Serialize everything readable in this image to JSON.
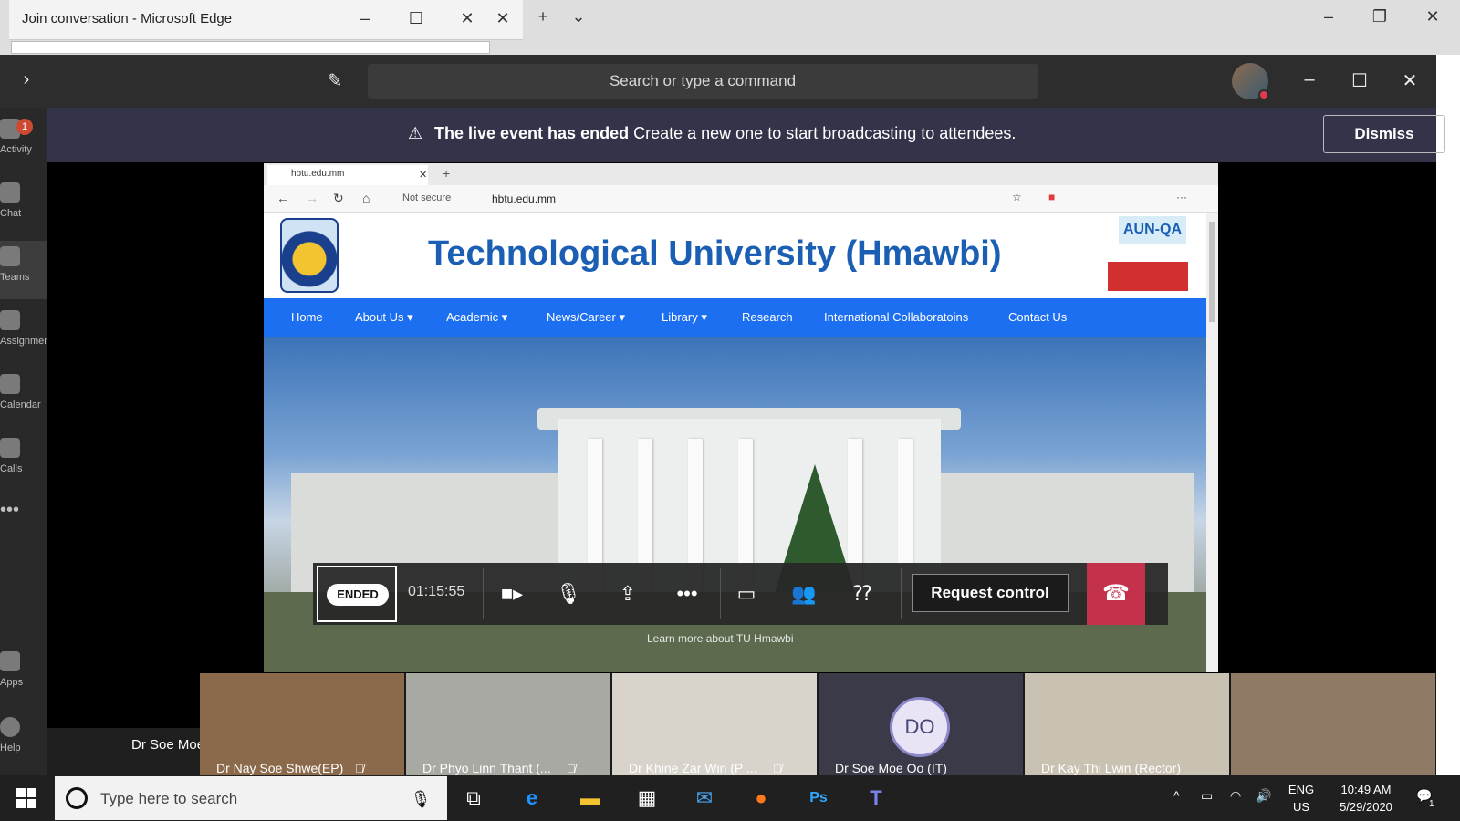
{
  "edge": {
    "title": "Join conversation - Microsoft Edge"
  },
  "teams": {
    "search_placeholder": "Search or type a command",
    "rail": [
      {
        "label": "Activity",
        "badge": "1"
      },
      {
        "label": "Chat"
      },
      {
        "label": "Teams"
      },
      {
        "label": "Assignments"
      },
      {
        "label": "Calendar"
      },
      {
        "label": "Calls"
      },
      {
        "label": "Apps"
      },
      {
        "label": "Help"
      }
    ],
    "banner": {
      "bold": "The live event has ended",
      "text": "Create a new one to start broadcasting to attendees.",
      "dismiss": "Dismiss"
    },
    "presenter": "Dr Soe Moe Oo (IT)"
  },
  "shared": {
    "tab_title": "hbtu.edu.mm",
    "not_secure": "Not secure",
    "url": "hbtu.edu.mm",
    "site_title": "Technological University (Hmawbi)",
    "badge_top": "AUN-QA",
    "menu": [
      "Home",
      "About Us ▾",
      "Academic ▾",
      "News/Career ▾",
      "Library ▾",
      "Research",
      "International Collaboratoins",
      "Contact Us"
    ],
    "hero_caption": "Learn more about TU Hmawbi"
  },
  "controls": {
    "status": "ENDED",
    "timer": "01:15:55",
    "request_control": "Request control"
  },
  "participants": [
    {
      "name": "Dr Nay Soe Shwe(EP)",
      "muted": true,
      "bg": "#8a6a4a"
    },
    {
      "name": "Dr Phyo Linn Thant (...",
      "muted": true,
      "bg": "#a9a9a4"
    },
    {
      "name": "Dr Khine Zar Win (P ...",
      "muted": true,
      "bg": "#d8d4cc"
    },
    {
      "name": "Dr Soe Moe Oo (IT)",
      "initials": "DO",
      "muted": false,
      "bg": "#3a3a48"
    },
    {
      "name": "Dr Kay Thi Lwin (Rector)",
      "muted": false,
      "bg": "#c9c1b2"
    },
    {
      "name": "",
      "muted": false,
      "bg": "#8f7a66"
    }
  ],
  "taskbar": {
    "search_placeholder": "Type here to search",
    "lang": "ENG",
    "region": "US",
    "time": "10:49 AM",
    "date": "5/29/2020",
    "notif_count": "1"
  },
  "colors": {
    "accent": "#1d6ff2",
    "teams_banner": "#33344a",
    "hangup": "#c4314b"
  }
}
